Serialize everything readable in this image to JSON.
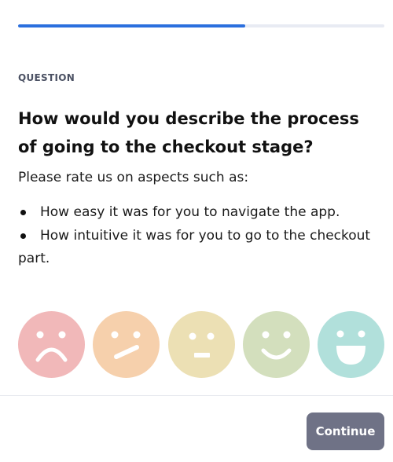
{
  "progress": {
    "value_percent": 62,
    "fill_color": "#2b6fde",
    "track_color": "#e8ebf3"
  },
  "question": {
    "section_label": "QUESTION",
    "title": "How would you describe the process of going to the checkout stage?",
    "description": "Please rate us on aspects such as:",
    "aspects": [
      "How easy it was for you to navigate the app.",
      "How intuitive it was for you to go to the checkout part."
    ]
  },
  "rating": {
    "options": [
      {
        "icon": "very-sad-face-icon",
        "color": "#f1b8b9"
      },
      {
        "icon": "skeptical-face-icon",
        "color": "#f6d0ac"
      },
      {
        "icon": "neutral-face-icon",
        "color": "#ece0b4"
      },
      {
        "icon": "smiling-face-icon",
        "color": "#d3dfbd"
      },
      {
        "icon": "grinning-face-icon",
        "color": "#b1e0db"
      }
    ]
  },
  "footer": {
    "continue_label": "Continue",
    "continue_color": "#6f7286"
  }
}
